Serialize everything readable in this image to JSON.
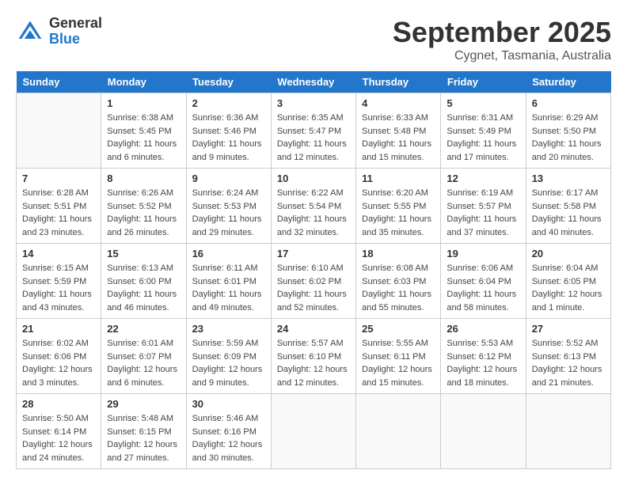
{
  "header": {
    "logo_general": "General",
    "logo_blue": "Blue",
    "month_title": "September 2025",
    "location": "Cygnet, Tasmania, Australia"
  },
  "days_of_week": [
    "Sunday",
    "Monday",
    "Tuesday",
    "Wednesday",
    "Thursday",
    "Friday",
    "Saturday"
  ],
  "weeks": [
    [
      {
        "day": "",
        "sunrise": "",
        "sunset": "",
        "daylight": ""
      },
      {
        "day": "1",
        "sunrise": "Sunrise: 6:38 AM",
        "sunset": "Sunset: 5:45 PM",
        "daylight": "Daylight: 11 hours and 6 minutes."
      },
      {
        "day": "2",
        "sunrise": "Sunrise: 6:36 AM",
        "sunset": "Sunset: 5:46 PM",
        "daylight": "Daylight: 11 hours and 9 minutes."
      },
      {
        "day": "3",
        "sunrise": "Sunrise: 6:35 AM",
        "sunset": "Sunset: 5:47 PM",
        "daylight": "Daylight: 11 hours and 12 minutes."
      },
      {
        "day": "4",
        "sunrise": "Sunrise: 6:33 AM",
        "sunset": "Sunset: 5:48 PM",
        "daylight": "Daylight: 11 hours and 15 minutes."
      },
      {
        "day": "5",
        "sunrise": "Sunrise: 6:31 AM",
        "sunset": "Sunset: 5:49 PM",
        "daylight": "Daylight: 11 hours and 17 minutes."
      },
      {
        "day": "6",
        "sunrise": "Sunrise: 6:29 AM",
        "sunset": "Sunset: 5:50 PM",
        "daylight": "Daylight: 11 hours and 20 minutes."
      }
    ],
    [
      {
        "day": "7",
        "sunrise": "Sunrise: 6:28 AM",
        "sunset": "Sunset: 5:51 PM",
        "daylight": "Daylight: 11 hours and 23 minutes."
      },
      {
        "day": "8",
        "sunrise": "Sunrise: 6:26 AM",
        "sunset": "Sunset: 5:52 PM",
        "daylight": "Daylight: 11 hours and 26 minutes."
      },
      {
        "day": "9",
        "sunrise": "Sunrise: 6:24 AM",
        "sunset": "Sunset: 5:53 PM",
        "daylight": "Daylight: 11 hours and 29 minutes."
      },
      {
        "day": "10",
        "sunrise": "Sunrise: 6:22 AM",
        "sunset": "Sunset: 5:54 PM",
        "daylight": "Daylight: 11 hours and 32 minutes."
      },
      {
        "day": "11",
        "sunrise": "Sunrise: 6:20 AM",
        "sunset": "Sunset: 5:55 PM",
        "daylight": "Daylight: 11 hours and 35 minutes."
      },
      {
        "day": "12",
        "sunrise": "Sunrise: 6:19 AM",
        "sunset": "Sunset: 5:57 PM",
        "daylight": "Daylight: 11 hours and 37 minutes."
      },
      {
        "day": "13",
        "sunrise": "Sunrise: 6:17 AM",
        "sunset": "Sunset: 5:58 PM",
        "daylight": "Daylight: 11 hours and 40 minutes."
      }
    ],
    [
      {
        "day": "14",
        "sunrise": "Sunrise: 6:15 AM",
        "sunset": "Sunset: 5:59 PM",
        "daylight": "Daylight: 11 hours and 43 minutes."
      },
      {
        "day": "15",
        "sunrise": "Sunrise: 6:13 AM",
        "sunset": "Sunset: 6:00 PM",
        "daylight": "Daylight: 11 hours and 46 minutes."
      },
      {
        "day": "16",
        "sunrise": "Sunrise: 6:11 AM",
        "sunset": "Sunset: 6:01 PM",
        "daylight": "Daylight: 11 hours and 49 minutes."
      },
      {
        "day": "17",
        "sunrise": "Sunrise: 6:10 AM",
        "sunset": "Sunset: 6:02 PM",
        "daylight": "Daylight: 11 hours and 52 minutes."
      },
      {
        "day": "18",
        "sunrise": "Sunrise: 6:08 AM",
        "sunset": "Sunset: 6:03 PM",
        "daylight": "Daylight: 11 hours and 55 minutes."
      },
      {
        "day": "19",
        "sunrise": "Sunrise: 6:06 AM",
        "sunset": "Sunset: 6:04 PM",
        "daylight": "Daylight: 11 hours and 58 minutes."
      },
      {
        "day": "20",
        "sunrise": "Sunrise: 6:04 AM",
        "sunset": "Sunset: 6:05 PM",
        "daylight": "Daylight: 12 hours and 1 minute."
      }
    ],
    [
      {
        "day": "21",
        "sunrise": "Sunrise: 6:02 AM",
        "sunset": "Sunset: 6:06 PM",
        "daylight": "Daylight: 12 hours and 3 minutes."
      },
      {
        "day": "22",
        "sunrise": "Sunrise: 6:01 AM",
        "sunset": "Sunset: 6:07 PM",
        "daylight": "Daylight: 12 hours and 6 minutes."
      },
      {
        "day": "23",
        "sunrise": "Sunrise: 5:59 AM",
        "sunset": "Sunset: 6:09 PM",
        "daylight": "Daylight: 12 hours and 9 minutes."
      },
      {
        "day": "24",
        "sunrise": "Sunrise: 5:57 AM",
        "sunset": "Sunset: 6:10 PM",
        "daylight": "Daylight: 12 hours and 12 minutes."
      },
      {
        "day": "25",
        "sunrise": "Sunrise: 5:55 AM",
        "sunset": "Sunset: 6:11 PM",
        "daylight": "Daylight: 12 hours and 15 minutes."
      },
      {
        "day": "26",
        "sunrise": "Sunrise: 5:53 AM",
        "sunset": "Sunset: 6:12 PM",
        "daylight": "Daylight: 12 hours and 18 minutes."
      },
      {
        "day": "27",
        "sunrise": "Sunrise: 5:52 AM",
        "sunset": "Sunset: 6:13 PM",
        "daylight": "Daylight: 12 hours and 21 minutes."
      }
    ],
    [
      {
        "day": "28",
        "sunrise": "Sunrise: 5:50 AM",
        "sunset": "Sunset: 6:14 PM",
        "daylight": "Daylight: 12 hours and 24 minutes."
      },
      {
        "day": "29",
        "sunrise": "Sunrise: 5:48 AM",
        "sunset": "Sunset: 6:15 PM",
        "daylight": "Daylight: 12 hours and 27 minutes."
      },
      {
        "day": "30",
        "sunrise": "Sunrise: 5:46 AM",
        "sunset": "Sunset: 6:16 PM",
        "daylight": "Daylight: 12 hours and 30 minutes."
      },
      {
        "day": "",
        "sunrise": "",
        "sunset": "",
        "daylight": ""
      },
      {
        "day": "",
        "sunrise": "",
        "sunset": "",
        "daylight": ""
      },
      {
        "day": "",
        "sunrise": "",
        "sunset": "",
        "daylight": ""
      },
      {
        "day": "",
        "sunrise": "",
        "sunset": "",
        "daylight": ""
      }
    ]
  ]
}
